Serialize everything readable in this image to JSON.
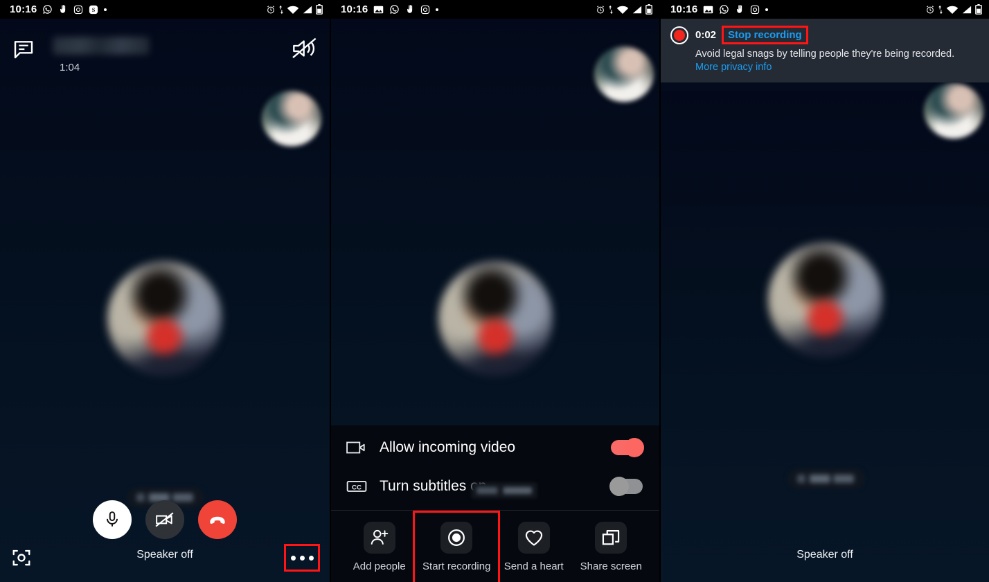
{
  "status_bar": {
    "time": "10:16",
    "left_icons": [
      "photos-icon",
      "whatsapp-icon",
      "hand-icon",
      "instagram-icon",
      "skype-icon",
      "more-dot-icon"
    ],
    "right_icons": [
      "alarm-icon",
      "data-transfer-icon",
      "wifi-icon",
      "signal-icon",
      "battery-icon"
    ]
  },
  "panel1": {
    "header": {
      "chat_icon": "chat-bubble-icon",
      "contact_name": "",
      "call_timer": "1:04",
      "speaker_icon": "speaker-muted-icon"
    },
    "name_pill": "",
    "controls": {
      "mic": {
        "label": "microphone-button",
        "icon": "microphone-icon",
        "state": "on"
      },
      "camera": {
        "label": "camera-button",
        "icon": "camera-off-icon",
        "state": "off"
      },
      "end_call": {
        "label": "end-call-button",
        "icon": "hang-up-icon"
      }
    },
    "bottom": {
      "capture_icon": "snapshot-icon",
      "speaker_label": "Speaker off",
      "more_label": "more-options-button",
      "more_highlighted": true
    }
  },
  "panel2": {
    "menu_rows": [
      {
        "icon": "video-camera-icon",
        "label": "Allow incoming video",
        "toggle": "on"
      },
      {
        "icon": "closed-caption-icon",
        "label": "Turn subtitles on",
        "toggle": "off"
      }
    ],
    "actions": [
      {
        "icon": "add-person-icon",
        "label": "Add people",
        "highlighted": false
      },
      {
        "icon": "record-icon",
        "label": "Start recording",
        "highlighted": true
      },
      {
        "icon": "heart-icon",
        "label": "Send a heart",
        "highlighted": false
      },
      {
        "icon": "share-screen-icon",
        "label": "Share screen",
        "highlighted": false
      }
    ]
  },
  "panel3": {
    "recording_banner": {
      "record_icon": "record-dot-icon",
      "elapsed": "0:02",
      "stop_label": "Stop recording",
      "notice_text": "Avoid legal snags by telling people they're being recorded. ",
      "notice_link": "More privacy info",
      "highlighted": true
    },
    "name_pill": "",
    "bottom": {
      "speaker_label": "Speaker off"
    }
  },
  "colors": {
    "accent_red": "#f04438",
    "toggle_on": "#f96a66",
    "toggle_off": "#9a9a9a",
    "link_blue": "#1b9df0",
    "highlight_box": "#ff1515",
    "banner_bg": "#252b35",
    "stage_bg": "#03091a"
  }
}
